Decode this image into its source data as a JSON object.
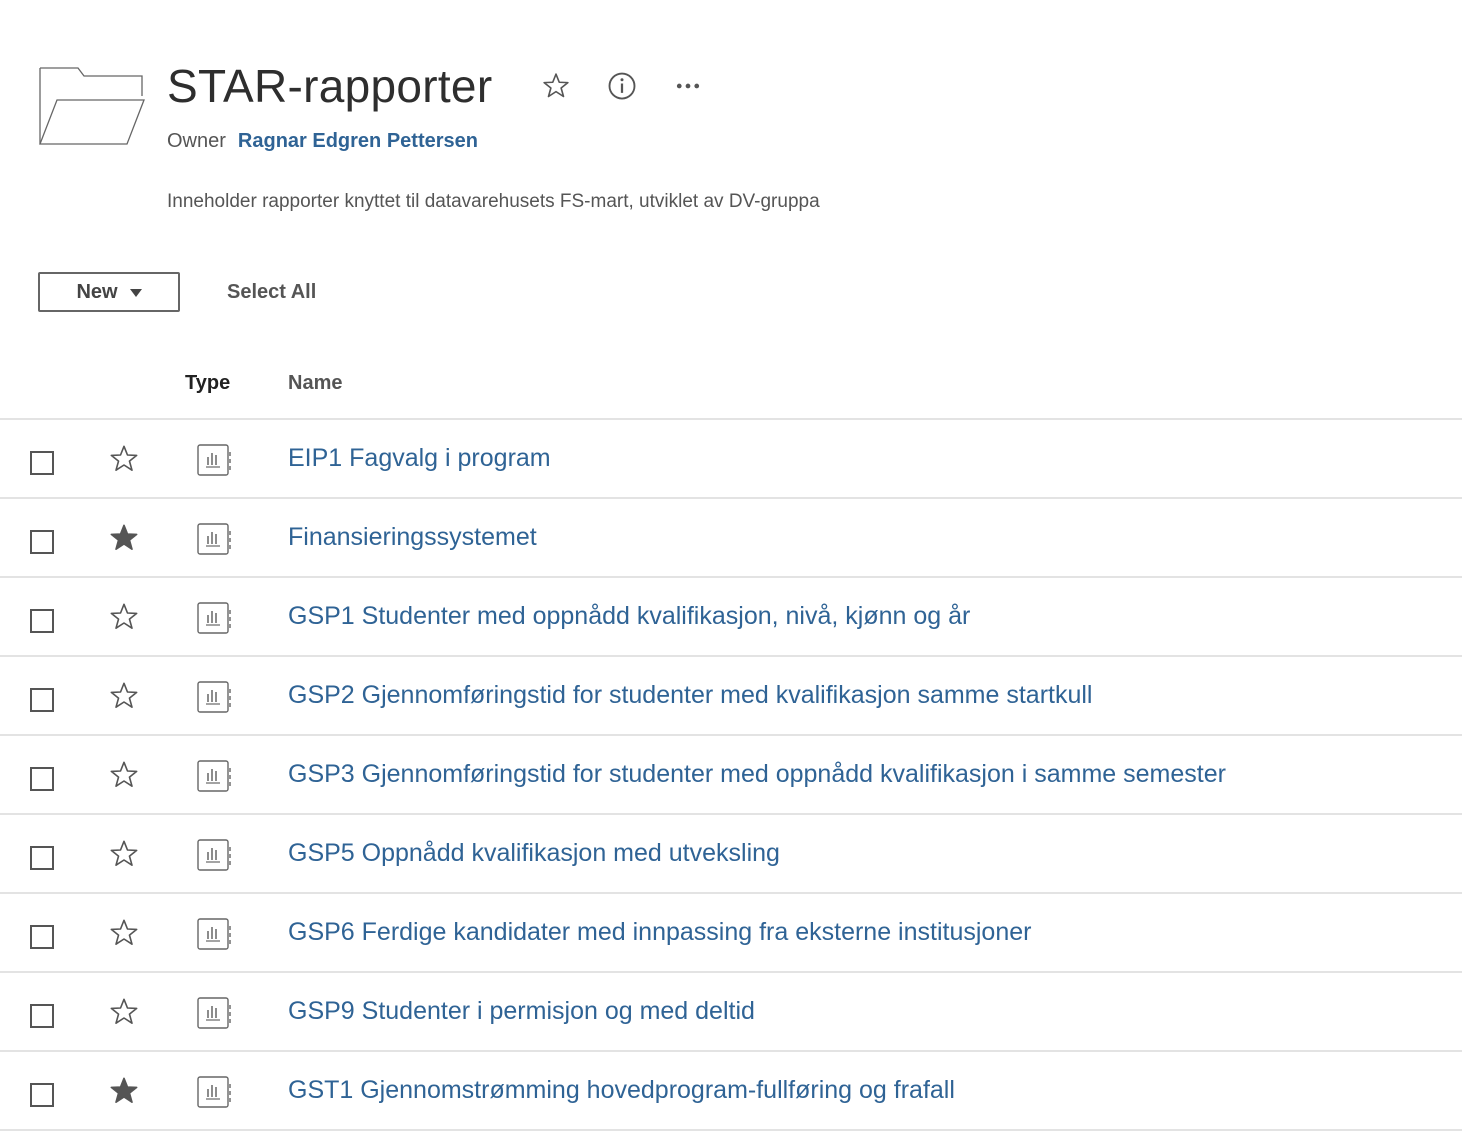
{
  "header": {
    "icon": "folder-icon",
    "title": "STAR-rapporter",
    "actions": [
      "star-outline-icon",
      "info-icon",
      "more-icon"
    ],
    "owner_label": "Owner",
    "owner_name": "Ragnar Edgren Pettersen",
    "description": "Inneholder rapporter knyttet til datavarehusets FS-mart, utviklet av DV-gruppa"
  },
  "toolbar": {
    "new_label": "New",
    "select_all_label": "Select All"
  },
  "table": {
    "columns": [
      "Type",
      "Name"
    ],
    "rows": [
      {
        "name": "EIP1 Fagvalg i program",
        "favorite": false,
        "type_icon": "workbook-icon"
      },
      {
        "name": "Finansieringssystemet",
        "favorite": true,
        "type_icon": "workbook-icon"
      },
      {
        "name": "GSP1 Studenter med oppnådd kvalifikasjon, nivå, kjønn og år",
        "favorite": false,
        "type_icon": "workbook-icon"
      },
      {
        "name": "GSP2 Gjennomføringstid for studenter med kvalifikasjon samme startkull",
        "favorite": false,
        "type_icon": "workbook-icon"
      },
      {
        "name": "GSP3 Gjennomføringstid for studenter med oppnådd kvalifikasjon i samme semester",
        "favorite": false,
        "type_icon": "workbook-icon"
      },
      {
        "name": "GSP5 Oppnådd kvalifikasjon med utveksling",
        "favorite": false,
        "type_icon": "workbook-icon"
      },
      {
        "name": "GSP6 Ferdige kandidater med innpassing fra eksterne institusjoner",
        "favorite": false,
        "type_icon": "workbook-icon"
      },
      {
        "name": "GSP9 Studenter i permisjon og med deltid",
        "favorite": false,
        "type_icon": "workbook-icon"
      },
      {
        "name": "GST1 Gjennomstrømming hovedprogram-fullføring og frafall",
        "favorite": true,
        "type_icon": "workbook-icon"
      }
    ]
  },
  "colors": {
    "link": "#2f6395",
    "text": "#333333",
    "divider": "#e3e3e3",
    "star_filled": "#555555"
  }
}
